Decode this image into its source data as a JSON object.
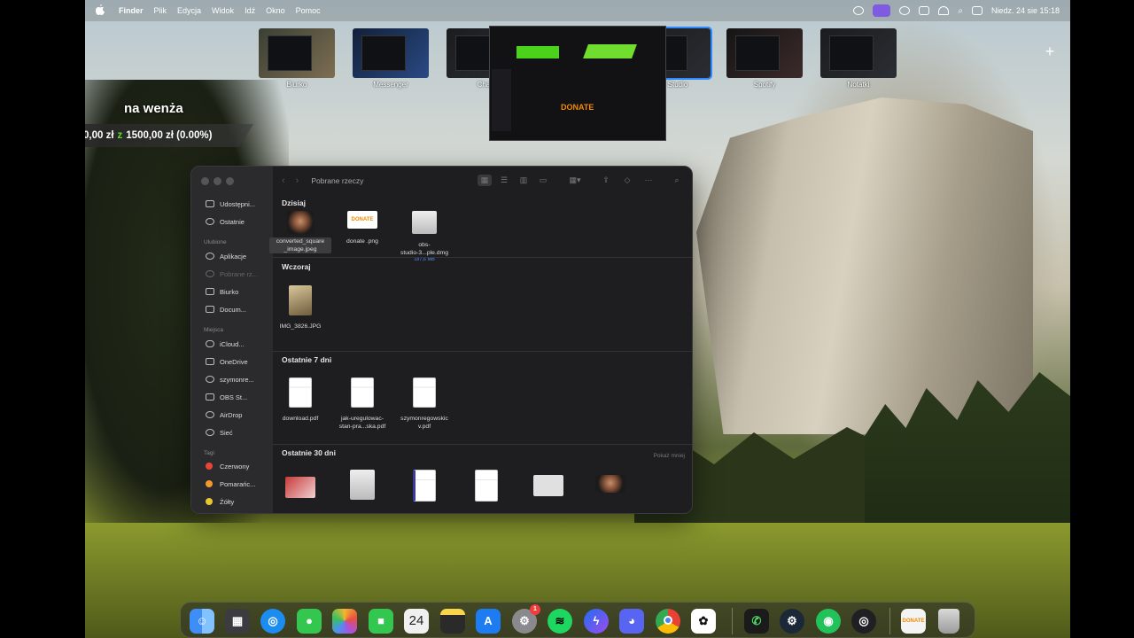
{
  "menubar": {
    "apple": "",
    "app": "Finder",
    "menus": [
      "Plik",
      "Edycja",
      "Widok",
      "Idź",
      "Okno",
      "Pomoc"
    ],
    "datetime": "Niedz. 24 sie  15:18",
    "icons": [
      "creative-cloud-icon",
      "stage-manager-icon",
      "screen-record-icon",
      "battery-icon",
      "wifi-icon",
      "search-icon",
      "control-center-icon"
    ]
  },
  "spaces": [
    {
      "label": "Biurko"
    },
    {
      "label": "Messenger"
    },
    {
      "label": "Chat"
    },
    {
      "label": "Studio"
    },
    {
      "label": "Spotify"
    },
    {
      "label": "Notatki"
    }
  ],
  "preview": {
    "donate": "DONATE"
  },
  "overlay": {
    "title": "na wenża",
    "current": "0,00 zł",
    "z": "z",
    "goal": "1500,00 zł (0.00%)"
  },
  "finder": {
    "title": "Pobrane rzeczy",
    "sidebar": {
      "items_top": [
        {
          "label": "Udostępni..."
        },
        {
          "label": "Ostatnie"
        }
      ],
      "favorites_header": "Ulubione",
      "favorites": [
        {
          "label": "Aplikacje"
        },
        {
          "label": "Pobrane rz..."
        },
        {
          "label": "Biurko"
        },
        {
          "label": "Docum..."
        }
      ],
      "places_header": "Miejsca",
      "places": [
        {
          "label": "iCloud..."
        },
        {
          "label": "OneDrive"
        },
        {
          "label": "szymonre..."
        },
        {
          "label": "OBS St..."
        },
        {
          "label": "AirDrop"
        },
        {
          "label": "Sieć"
        }
      ],
      "tags_header": "Tagi",
      "tags": [
        {
          "label": "Czerwony",
          "color": "#e8443a"
        },
        {
          "label": "Pomarańc...",
          "color": "#f29a2e"
        },
        {
          "label": "Żółty",
          "color": "#e6c82e"
        }
      ]
    },
    "groups": {
      "today": {
        "header": "Dzisiaj",
        "files": [
          {
            "name": "converted_square_image.jpeg",
            "line1": "converted_square",
            "line2": "_image.jpeg"
          },
          {
            "name": "donate .png",
            "line1": "donate .png",
            "thumb_text": "DONATE"
          },
          {
            "name": "obs-studio-3...ple.dmg",
            "line1": "obs-",
            "line2": "studio-3...ple.dmg",
            "meta": "187,6 MB"
          }
        ]
      },
      "yesterday": {
        "header": "Wczoraj",
        "files": [
          {
            "name": "IMG_3826.JPG"
          }
        ]
      },
      "last7": {
        "header": "Ostatnie 7 dni",
        "files": [
          {
            "line1": "download.pdf"
          },
          {
            "line1": "jak-uregulowac-",
            "line2": "stan-pra...ska.pdf"
          },
          {
            "line1": "szymonregowskic",
            "line2": "v.pdf"
          }
        ]
      },
      "last30": {
        "header": "Ostatnie 30 dni",
        "show_less": "Pokaż mniej"
      }
    }
  },
  "dock": {
    "calendar_day": "24",
    "settings_badge": "1",
    "donate_label": "DONATE",
    "apps": [
      "finder-icon",
      "launchpad-icon",
      "safari-icon",
      "messages-icon",
      "photos-icon",
      "facetime-icon",
      "calendar-icon",
      "notes-icon",
      "app-store-icon",
      "settings-icon",
      "spotify-icon",
      "messenger-icon",
      "discord-icon",
      "chrome-icon",
      "chatgpt-icon",
      "phone-icon",
      "steam-icon",
      "green-app-icon",
      "obs-icon",
      "donate-preview-icon",
      "trash-icon"
    ]
  }
}
